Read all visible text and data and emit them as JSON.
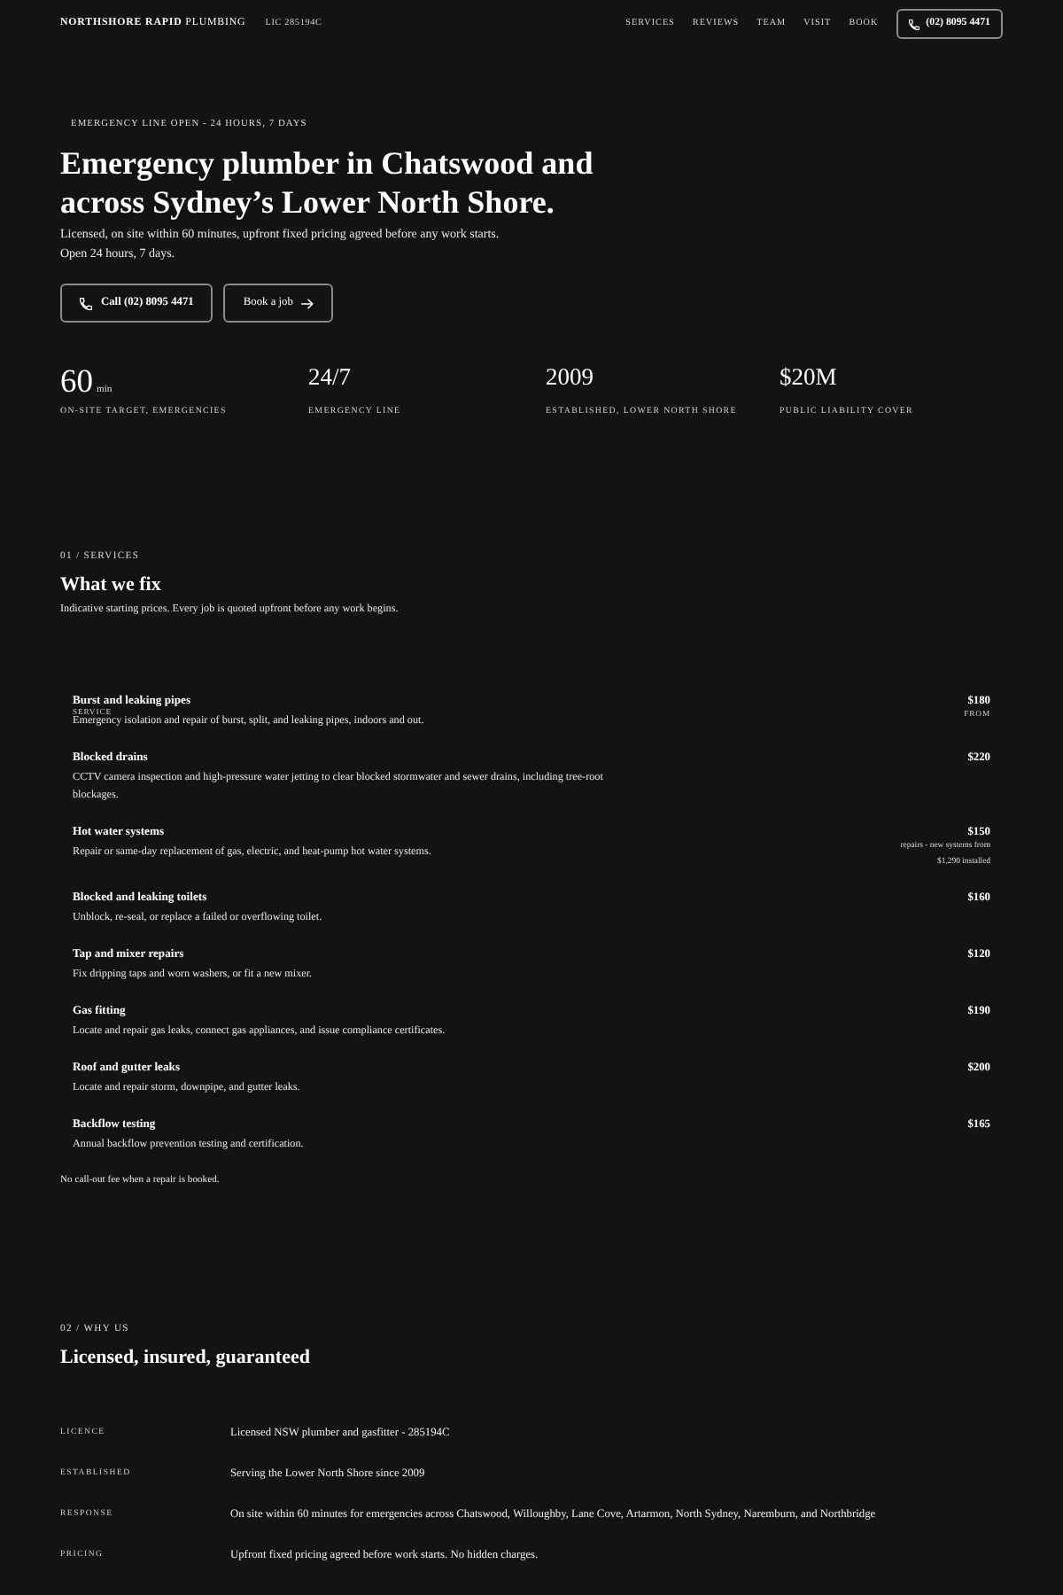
{
  "nav": {
    "brand": "**NORTHSHORE RAPID** PLUMBING",
    "licence": "LIC 285194C",
    "links": [
      "SERVICES",
      "REVIEWS",
      "TEAM",
      "VISIT",
      "BOOK"
    ],
    "phone": "(02) 8095 4471"
  },
  "hero": {
    "status": "EMERGENCY LINE OPEN - 24 HOURS, 7 DAYS",
    "title": "Emergency plumber in Chatswood and across Sydney’s Lower North Shore.",
    "lead": [
      "Licensed, on site within 60 minutes, upfront fixed pricing agreed before any work starts.",
      "Open 24 hours, 7 days."
    ],
    "buttons": [
      {
        "kind": "call",
        "label": "Call (02) 8095 4471"
      },
      {
        "kind": "book",
        "label": "Book a job"
      }
    ]
  },
  "stats": [
    {
      "kind": "featured",
      "value": "60",
      "unit": "min",
      "label": "ON-SITE TARGET, EMERGENCIES"
    },
    {
      "kind": "standard",
      "value": "24/7",
      "label": "EMERGENCY LINE"
    },
    {
      "kind": "standard",
      "value": "2009",
      "label": "ESTABLISHED, LOWER NORTH SHORE"
    },
    {
      "kind": "standard",
      "value": "$20M",
      "label": "PUBLIC LIABILITY COVER"
    }
  ],
  "services": {
    "eyebrow": "01 / SERVICES",
    "title": "What we fix",
    "subtitle": "Indicative starting prices. Every job is quoted upfront before any work begins.",
    "items": [
      {
        "name": "Burst and leaking pipes",
        "tag": "SERVICE",
        "description": "Emergency isolation and repair of burst, split, and leaking pipes, indoors and out.",
        "price": "$180",
        "price_label": "FROM"
      },
      {
        "name": "Blocked drains",
        "description": "CCTV camera inspection and high-pressure water jetting to clear blocked stormwater and sewer drains, including tree-root blockages.",
        "price": "$220"
      },
      {
        "name": "Hot water systems",
        "description": "Repair or same-day replacement of gas, electric, and heat-pump hot water systems.",
        "price": "$150",
        "price_note": "repairs - new systems from $1,290 installed"
      },
      {
        "name": "Blocked and leaking toilets",
        "description": "Unblock, re-seal, or replace a failed or overflowing toilet.",
        "price": "$160"
      },
      {
        "name": "Tap and mixer repairs",
        "description": "Fix dripping taps and worn washers, or fit a new mixer.",
        "price": "$120"
      },
      {
        "name": "Gas fitting",
        "description": "Locate and repair gas leaks, connect gas appliances, and issue compliance certificates.",
        "price": "$190"
      },
      {
        "name": "Roof and gutter leaks",
        "description": "Locate and repair storm, downpipe, and gutter leaks.",
        "price": "$200"
      },
      {
        "name": "Backflow testing",
        "description": "Annual backflow prevention testing and certification.",
        "price": "$165"
      }
    ],
    "footnote": "No call-out fee when a repair is booked."
  },
  "why_us": {
    "eyebrow": "02 / WHY US",
    "title": "Licensed, insured, guaranteed",
    "facts": [
      {
        "label": "LICENCE",
        "value": "Licensed NSW plumber and gasfitter - 285194C"
      },
      {
        "label": "ESTABLISHED",
        "value": "Serving the Lower North Shore since 2009"
      },
      {
        "label": "RESPONSE",
        "value": "On site within 60 minutes for emergencies across Chatswood, Willoughby, Lane Cove, Artarmon, North Sydney, Naremburn, and Northbridge"
      },
      {
        "label": "PRICING",
        "value": "Upfront fixed pricing agreed before work starts. No hidden charges."
      }
    ]
  }
}
